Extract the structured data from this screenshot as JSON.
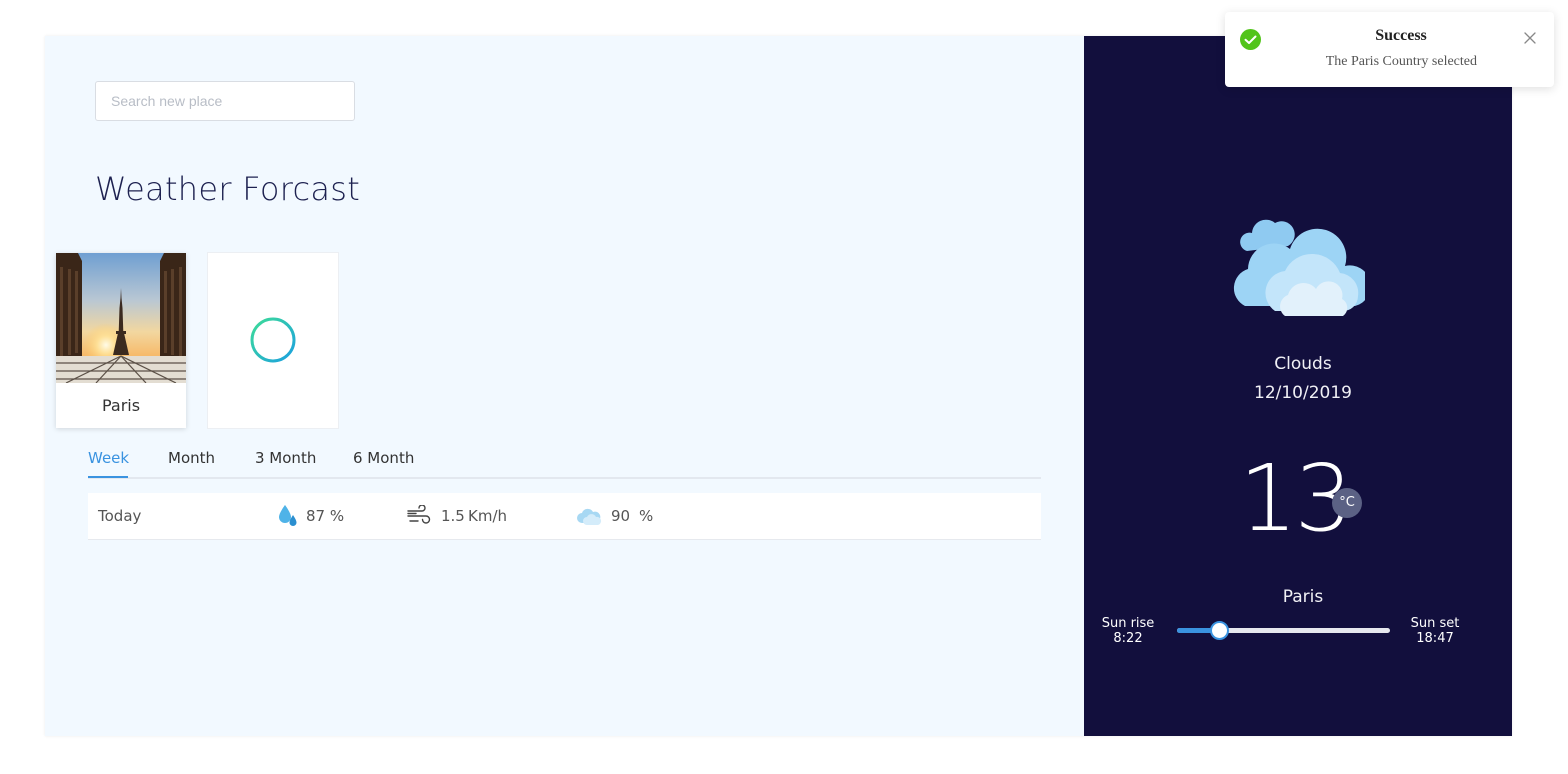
{
  "search": {
    "placeholder": "Search new place",
    "value": ""
  },
  "page_title": "Weather Forcast",
  "cities": [
    {
      "name": "Paris",
      "image": "eiffel-tower-photo"
    }
  ],
  "add_city_icon": "plus-circle-icon",
  "tabs": [
    {
      "label": "Week",
      "active": true
    },
    {
      "label": "Month",
      "active": false
    },
    {
      "label": "3 Month",
      "active": false
    },
    {
      "label": "6 Month",
      "active": false
    }
  ],
  "forecast_rows": [
    {
      "day": "Today",
      "humidity_icon": "water-drops-icon",
      "humidity": "87 %",
      "wind_icon": "wind-icon",
      "wind_value": "1.5",
      "wind_unit": "Km/h",
      "cloud_icon": "cloud-icon",
      "cloud_value": "90",
      "cloud_unit": "%"
    }
  ],
  "current": {
    "icon": "clouds-icon",
    "description": "Clouds",
    "date": "12/10/2019",
    "temperature": "13",
    "unit": "°C",
    "place": "Paris",
    "sunrise_label": "Sun rise",
    "sunrise_time": "8:22",
    "sunset_label": "Sun set",
    "sunset_time": "18:47",
    "sun_progress": 0.2
  },
  "toast": {
    "icon": "check-circle-icon",
    "title": "Success",
    "message": "The Paris Country selected",
    "close_icon": "close-icon"
  },
  "colors": {
    "background": "#f2f9ff",
    "side_panel": "#120f3d",
    "accent": "#3a93e0",
    "add_gradient_start": "#3ddc97",
    "add_gradient_end": "#1ba0e0",
    "success": "#52c41a"
  }
}
